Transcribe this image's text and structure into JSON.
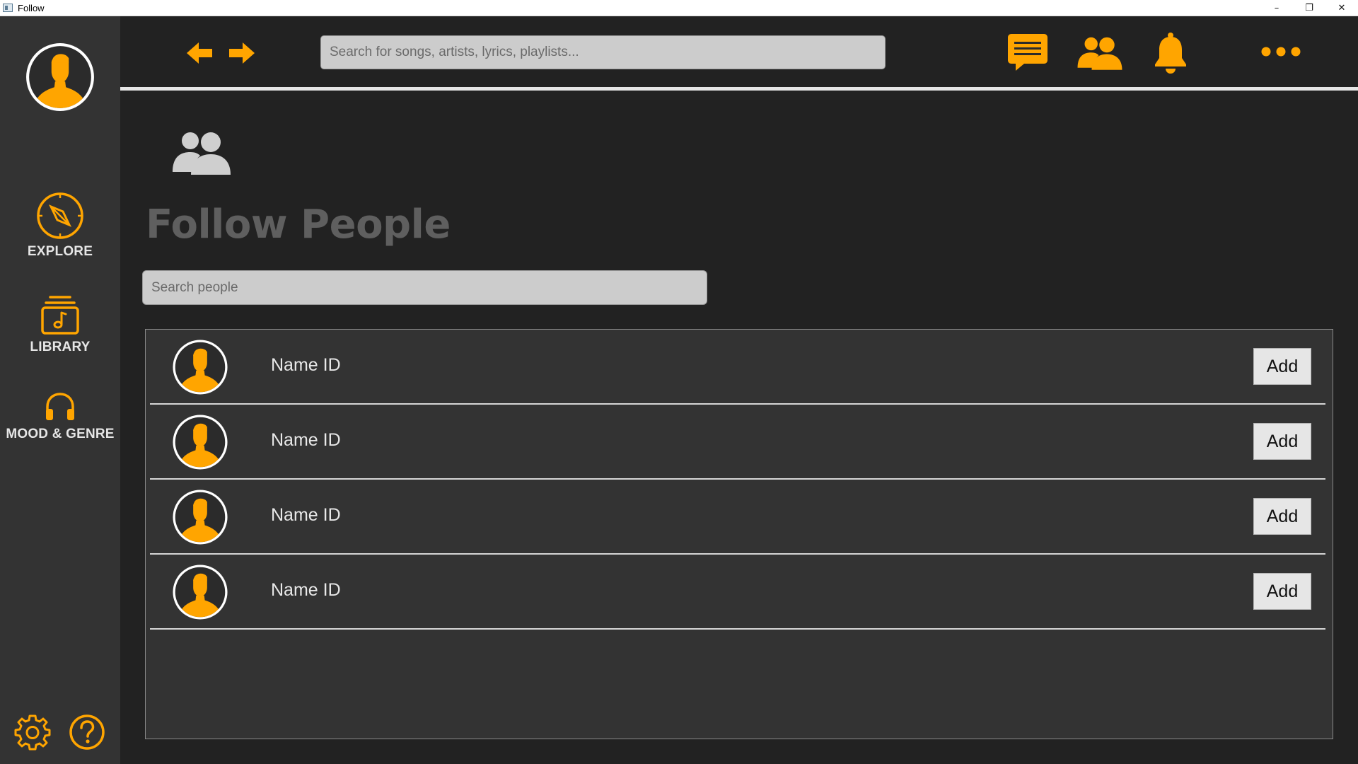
{
  "window": {
    "title": "Follow",
    "controls": {
      "minimize": "–",
      "restore": "❐",
      "close": "✕"
    }
  },
  "colors": {
    "accent": "#FFA500",
    "sidebar_bg": "#333333",
    "main_bg": "#222222",
    "panel_bg": "#333333",
    "title_text": "#5F5F5F"
  },
  "sidebar": {
    "avatar_icon": "user-avatar-icon",
    "items": [
      {
        "label": "EXPLORE",
        "icon": "compass-icon"
      },
      {
        "label": "LIBRARY",
        "icon": "music-library-icon"
      },
      {
        "label": "MOOD & GENRE",
        "icon": "headphones-icon"
      }
    ],
    "bottom_icons": [
      "gear-icon",
      "help-icon"
    ]
  },
  "topbar": {
    "back_icon": "arrow-left-icon",
    "forward_icon": "arrow-right-icon",
    "search_placeholder": "Search for songs, artists, lyrics, playlists...",
    "right_icons": [
      "chat-icon",
      "friends-icon",
      "bell-icon",
      "more-icon"
    ]
  },
  "page": {
    "icon": "people-icon",
    "title": "Follow People",
    "search_placeholder": "Search people"
  },
  "people": [
    {
      "name": "Name ID",
      "action": "Add"
    },
    {
      "name": "Name ID",
      "action": "Add"
    },
    {
      "name": "Name ID",
      "action": "Add"
    },
    {
      "name": "Name ID",
      "action": "Add"
    }
  ]
}
